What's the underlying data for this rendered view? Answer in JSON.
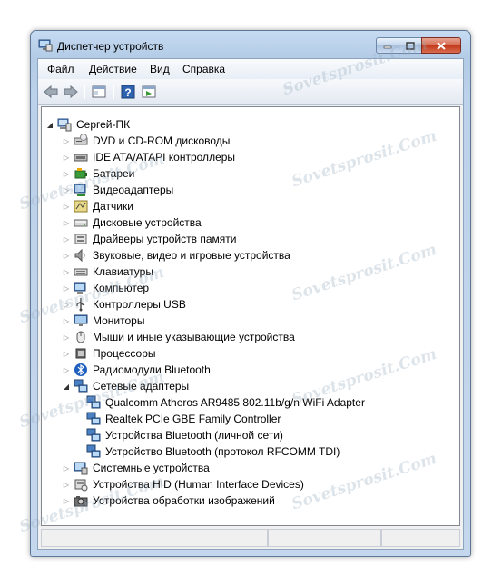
{
  "window": {
    "title": "Диспетчер устройств"
  },
  "menu": [
    "Файл",
    "Действие",
    "Вид",
    "Справка"
  ],
  "tree": {
    "root": "Сергей-ПК",
    "items": [
      {
        "label": "DVD и CD-ROM дисководы",
        "icon": "dvd-drive-icon",
        "expanded": false
      },
      {
        "label": "IDE ATA/ATAPI контроллеры",
        "icon": "ide-controller-icon",
        "expanded": false
      },
      {
        "label": "Батареи",
        "icon": "battery-icon",
        "expanded": false
      },
      {
        "label": "Видеоадаптеры",
        "icon": "display-adapter-icon",
        "expanded": false
      },
      {
        "label": "Датчики",
        "icon": "sensor-icon",
        "expanded": false
      },
      {
        "label": "Дисковые устройства",
        "icon": "disk-drive-icon",
        "expanded": false
      },
      {
        "label": "Драйверы устройств памяти",
        "icon": "memory-device-icon",
        "expanded": false
      },
      {
        "label": "Звуковые, видео и игровые устройства",
        "icon": "sound-icon",
        "expanded": false
      },
      {
        "label": "Клавиатуры",
        "icon": "keyboard-icon",
        "expanded": false
      },
      {
        "label": "Компьютер",
        "icon": "computer-icon",
        "expanded": false
      },
      {
        "label": "Контроллеры USB",
        "icon": "usb-icon",
        "expanded": false
      },
      {
        "label": "Мониторы",
        "icon": "monitor-icon",
        "expanded": false
      },
      {
        "label": "Мыши и иные указывающие устройства",
        "icon": "mouse-icon",
        "expanded": false
      },
      {
        "label": "Процессоры",
        "icon": "processor-icon",
        "expanded": false
      },
      {
        "label": "Радиомодули Bluetooth",
        "icon": "bluetooth-icon",
        "expanded": false
      },
      {
        "label": "Сетевые адаптеры",
        "icon": "network-adapter-icon",
        "expanded": true,
        "children": [
          "Qualcomm Atheros AR9485 802.11b/g/n WiFi Adapter",
          "Realtek PCIe GBE Family Controller",
          "Устройства Bluetooth (личной сети)",
          "Устройство Bluetooth (протокол RFCOMM TDI)"
        ]
      },
      {
        "label": "Системные устройства",
        "icon": "system-device-icon",
        "expanded": false
      },
      {
        "label": "Устройства HID (Human Interface Devices)",
        "icon": "hid-icon",
        "expanded": false
      },
      {
        "label": "Устройства обработки изображений",
        "icon": "camera-icon",
        "expanded": false
      }
    ]
  },
  "watermark": "Sovetsprosit.Com",
  "colors": {
    "frame": "#b8cee8",
    "close": "#c94a2d"
  }
}
